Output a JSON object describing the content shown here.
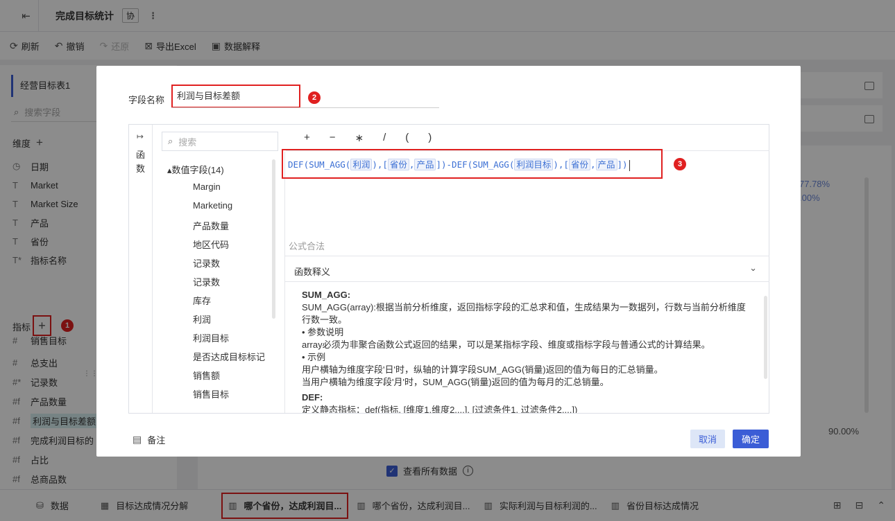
{
  "app": {
    "title": "完成目标统计",
    "coop_label": "协",
    "more_label": "⋮"
  },
  "toolbar": {
    "refresh": "刷新",
    "undo": "撤销",
    "redo": "还原",
    "export_excel": "导出Excel",
    "data_explain": "数据解释"
  },
  "left_panel": {
    "table_tab": "经营目标表1",
    "search_placeholder": "搜索字段",
    "dimension_label": "维度",
    "dimensions": [
      {
        "type_icon": "◷",
        "label": "日期"
      },
      {
        "type_icon": "T",
        "label": "Market"
      },
      {
        "type_icon": "T",
        "label": "Market Size"
      },
      {
        "type_icon": "T",
        "label": "产品"
      },
      {
        "type_icon": "T",
        "label": "省份"
      },
      {
        "type_icon": "T*",
        "label": "指标名称"
      }
    ],
    "metric_label": "指标",
    "metrics": [
      {
        "type_icon": "#",
        "label": "销售目标"
      },
      {
        "type_icon": "#",
        "label": "总支出"
      },
      {
        "type_icon": "#*",
        "label": "记录数"
      },
      {
        "type_icon": "#f",
        "label": "产品数量"
      },
      {
        "type_icon": "#f",
        "label": "利润与目标差额"
      },
      {
        "type_icon": "#f",
        "label": "完成利润目标的"
      },
      {
        "type_icon": "#f",
        "label": "占比"
      },
      {
        "type_icon": "#f",
        "label": "总商品数"
      }
    ],
    "badge_1": "1"
  },
  "background": {
    "value_a": "77.78%",
    "value_b": ".00%",
    "value_c": "90.00%",
    "show_all_data": "查看所有数据"
  },
  "dialog": {
    "field_name_label": "字段名称",
    "field_name_value": "利润与目标差额",
    "badge_2": "2",
    "badge_3": "3",
    "fn_arrow": "↦",
    "fn_vertical": "函数",
    "field_search_placeholder": "搜索",
    "tree_root": "数值字段(14)",
    "tree_items": [
      "Margin",
      "Marketing",
      "产品数量",
      "地区代码",
      "记录数",
      "记录数",
      "库存",
      "利润",
      "利润目标",
      "是否达成目标标记",
      "销售额",
      "销售目标"
    ],
    "operators": [
      "+",
      "−",
      "∗",
      "/",
      "(",
      ")"
    ],
    "formula": {
      "p1": "DEF(SUM_AGG(",
      "c1": "利润",
      "p2": "),[",
      "c2": "省份",
      "p3": ",",
      "c3": "产品",
      "p4": "])-DEF(SUM_AGG(",
      "c4": "利润目标",
      "p5": "),[",
      "c5": "省份",
      "p6": ",",
      "c6": "产品",
      "p7": "])"
    },
    "formula_status": "公式合法",
    "help_title": "函数释义",
    "help": {
      "h1": "SUM_AGG:",
      "l1": "SUM_AGG(array):根据当前分析维度，返回指标字段的汇总求和值，生成结果为一数据列，行数与当前分析维度行数一致。",
      "l2": "• 参数说明",
      "l3": "array必须为非聚合函数公式返回的结果，可以是某指标字段、维度或指标字段与普通公式的计算结果。",
      "l4": "• 示例",
      "l5": "用户横轴为维度字段'日'时，纵轴的计算字段SUM_AGG(销量)返回的值为每日的汇总销量。",
      "l6": "当用户横轴为维度字段'月'时，SUM_AGG(销量)返回的值为每月的汇总销量。",
      "h2": "DEF:",
      "l7": "定义静态指标：def(指标, [维度1,维度2,...], [过滤条件1, 过滤条件2,...])"
    },
    "note_label": "备注",
    "cancel_label": "取消",
    "ok_label": "确定"
  },
  "bottom_tabs": [
    {
      "label": "数据"
    },
    {
      "label": "目标达成情况分解"
    },
    {
      "label": "哪个省份，达成利润目..."
    },
    {
      "label": "哪个省份，达成利润目..."
    },
    {
      "label": "实际利润与目标利润的..."
    },
    {
      "label": "省份目标达成情况"
    }
  ]
}
